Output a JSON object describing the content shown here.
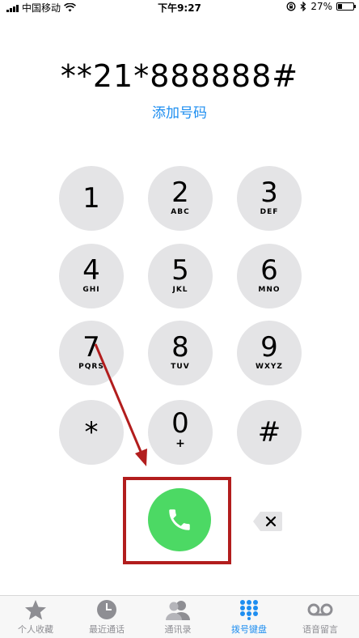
{
  "status_bar": {
    "carrier": "中国移动",
    "time": "下午9:27",
    "battery": "27%",
    "battery_level": 0.27,
    "icons": [
      "signal-icon",
      "wifi-icon",
      "rotation-lock-icon",
      "bluetooth-icon",
      "battery-icon"
    ]
  },
  "dialer": {
    "number": "**21*888888#",
    "add_number": "添加号码"
  },
  "keypad": [
    {
      "digit": "1",
      "letters": ""
    },
    {
      "digit": "2",
      "letters": "ABC"
    },
    {
      "digit": "3",
      "letters": "DEF"
    },
    {
      "digit": "4",
      "letters": "GHI"
    },
    {
      "digit": "5",
      "letters": "JKL"
    },
    {
      "digit": "6",
      "letters": "MNO"
    },
    {
      "digit": "7",
      "letters": "PQRS"
    },
    {
      "digit": "8",
      "letters": "TUV"
    },
    {
      "digit": "9",
      "letters": "WXYZ"
    },
    {
      "digit": "*",
      "letters": ""
    },
    {
      "digit": "0",
      "letters": "+"
    },
    {
      "digit": "#",
      "letters": ""
    }
  ],
  "actions": {
    "call_icon": "phone-icon",
    "delete_icon": "backspace-icon"
  },
  "annotation": {
    "highlight_color": "#b21d1d"
  },
  "tabs": [
    {
      "label": "个人收藏",
      "icon": "star-icon",
      "active": false
    },
    {
      "label": "最近通话",
      "icon": "clock-icon",
      "active": false
    },
    {
      "label": "通讯录",
      "icon": "contacts-icon",
      "active": false
    },
    {
      "label": "拨号键盘",
      "icon": "keypad-icon",
      "active": true
    },
    {
      "label": "语音留言",
      "icon": "voicemail-icon",
      "active": false
    }
  ],
  "colors": {
    "accent": "#1e8ef0",
    "call_green": "#4cd964",
    "key_gray": "#e4e4e6"
  }
}
